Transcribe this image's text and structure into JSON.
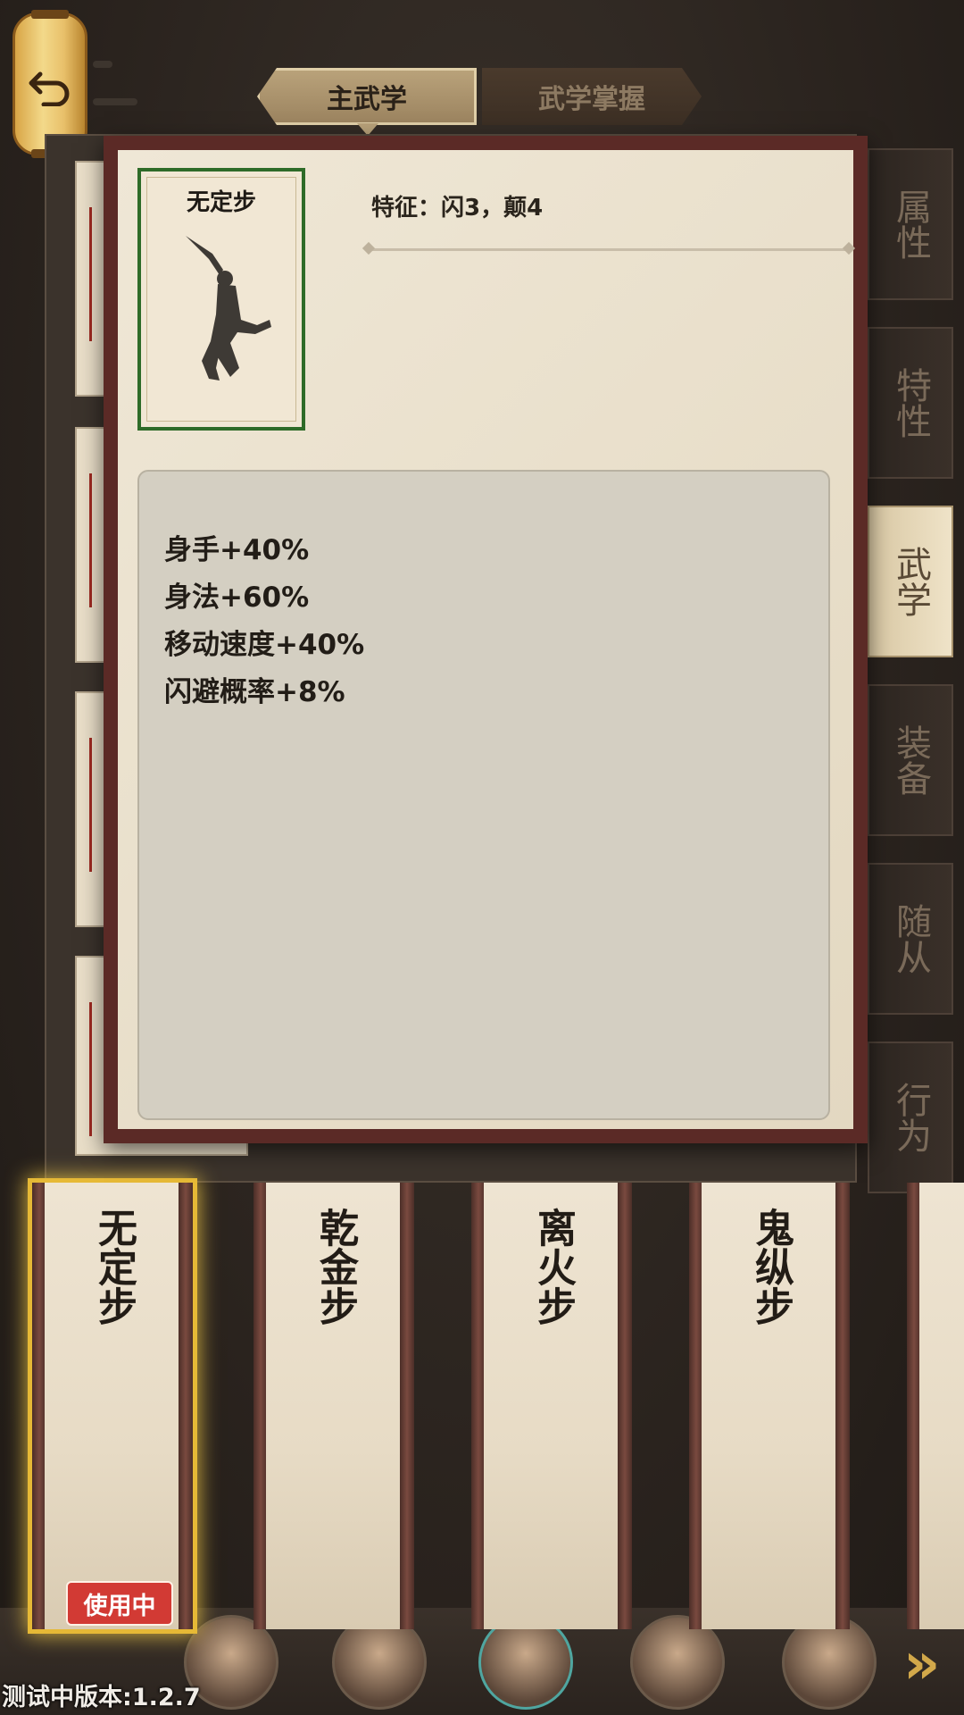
{
  "tabs": {
    "main": "主武学",
    "mastery": "武学掌握"
  },
  "side_tabs": [
    {
      "label": "属性",
      "active": false
    },
    {
      "label": "特性",
      "active": false
    },
    {
      "label": "武学",
      "active": true
    },
    {
      "label": "装备",
      "active": false
    },
    {
      "label": "随从",
      "active": false
    },
    {
      "label": "行为",
      "active": false
    }
  ],
  "popup": {
    "skill_name": "无定步",
    "feature_text": "特征：闪3，颠4",
    "stats": [
      "身手+40%",
      "身法+60%",
      "移动速度+40%",
      "闪避概率+8%"
    ]
  },
  "scrolls": [
    {
      "title": "无定步",
      "selected": true,
      "badge": "使用中"
    },
    {
      "title": "乾金步",
      "selected": false
    },
    {
      "title": "离火步",
      "selected": false
    },
    {
      "title": "鬼纵步",
      "selected": false
    }
  ],
  "version": "测试中版本:1.2.7",
  "colors": {
    "accent_gold": "#e6b936",
    "in_use_red": "#d23a34",
    "popup_frame": "#5b2a26",
    "icon_border": "#2e6b28"
  },
  "icons": [
    "back-arrow-icon",
    "martial-pose-icon",
    "next-arrow-icon"
  ]
}
